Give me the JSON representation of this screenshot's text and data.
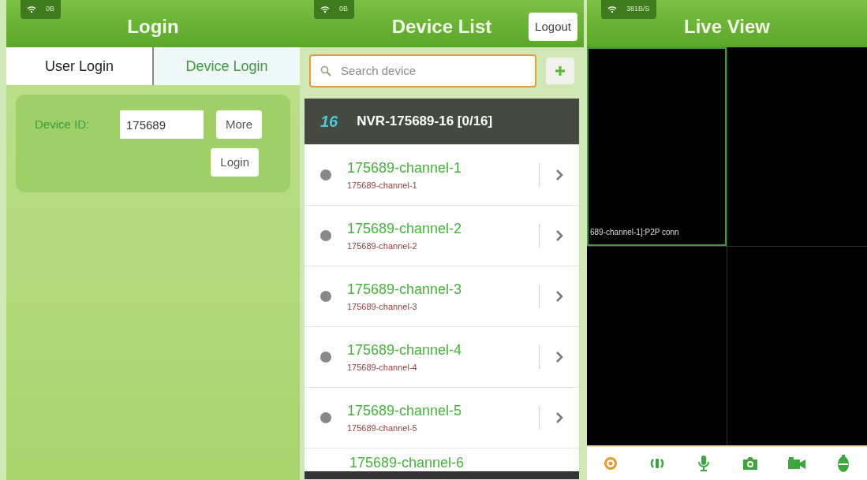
{
  "login_screen": {
    "status": {
      "speed": "0B"
    },
    "title": "Login",
    "tabs": [
      {
        "label": "User Login",
        "selected": true
      },
      {
        "label": "Device Login",
        "selected": false
      }
    ],
    "device_id": {
      "label": "Device ID:",
      "value": "175689"
    },
    "buttons": [
      "More",
      "Login"
    ]
  },
  "device_list_screen": {
    "status": {
      "speed": "0B"
    },
    "title": "Device List",
    "logout": "Logout",
    "search": {
      "placeholder": "Search device"
    },
    "group": {
      "badge": "16",
      "name": "NVR-175689-16 [0/16]"
    },
    "channels": [
      {
        "name": "175689-channel-1",
        "subtitle": "175689-channel-1",
        "online": false
      },
      {
        "name": "175689-channel-2",
        "subtitle": "175689-channel-2",
        "online": false
      },
      {
        "name": "175689-channel-3",
        "subtitle": "175689-channel-3",
        "online": false
      },
      {
        "name": "175689-channel-4",
        "subtitle": "175689-channel-4",
        "online": false
      },
      {
        "name": "175689-channel-5",
        "subtitle": "175689-channel-5",
        "online": false
      }
    ],
    "partial_channel": "175689-channel-6"
  },
  "live_view_screen": {
    "status": {
      "speed": "381B/S"
    },
    "title": "Live View",
    "cells": [
      {
        "overlay": "689-channel-1]:P2P conn",
        "selected": true
      },
      {
        "selected": false
      },
      {
        "selected": false
      },
      {
        "selected": false
      }
    ],
    "toolbar": [
      {
        "selected": true
      },
      {
        "selected": false
      },
      {
        "selected": false
      },
      {
        "selected": false
      },
      {
        "selected": false
      },
      {
        "selected": false
      }
    ]
  }
}
